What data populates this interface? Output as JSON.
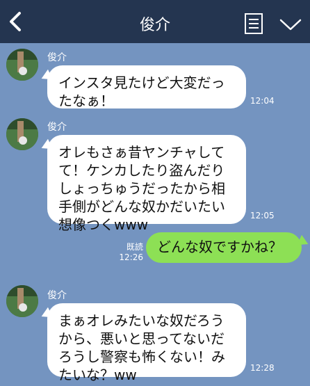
{
  "header": {
    "title": "俊介",
    "back_icon": "chevron-left-icon",
    "notes_icon": "note-list-icon",
    "menu_icon": "chevron-down-icon",
    "bg_color": "#243550"
  },
  "chat": {
    "bg_color": "#7494c0",
    "messages": [
      {
        "sender": "俊介",
        "direction": "in",
        "text": "インスタ見たけど大変だったなぁ！",
        "time": "12:04"
      },
      {
        "sender": "俊介",
        "direction": "in",
        "text": "オレもさぁ昔ヤンチャしてて！ケンカしたり盗んだりしょっちゅうだったから相手側がどんな奴かだいたい想像つくwww",
        "time": "12:05"
      },
      {
        "direction": "out",
        "text": "どんな奴ですかね？",
        "read_label": "既読",
        "time": "12:26"
      },
      {
        "sender": "俊介",
        "direction": "in",
        "text": "まぁオレみたいな奴だろうから、悪いと思ってないだろうし警察も怖くない！みたいな？ww",
        "time": "12:28"
      }
    ]
  },
  "colors": {
    "incoming_bubble": "#ffffff",
    "outgoing_bubble": "#8de055"
  }
}
